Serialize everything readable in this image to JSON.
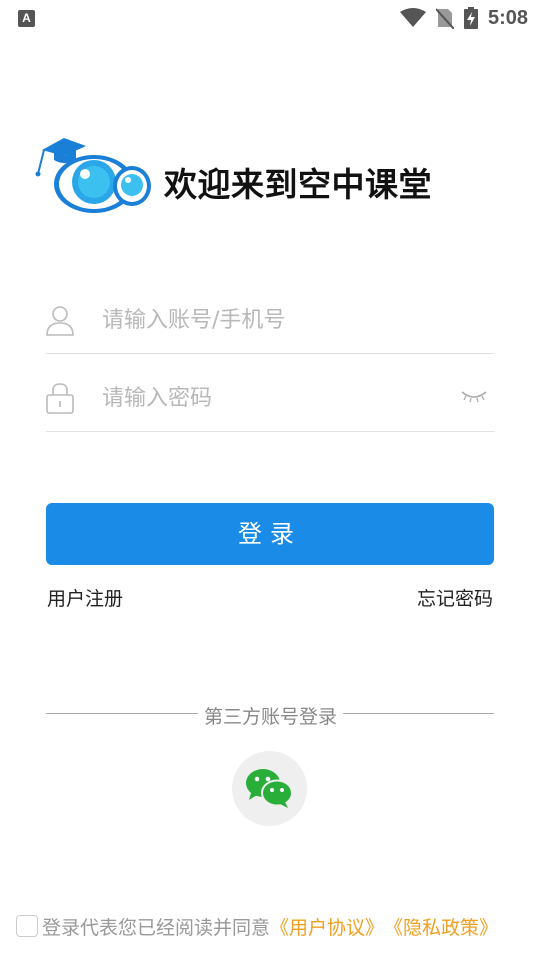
{
  "status_bar": {
    "left_icon_letter": "A",
    "time": "5:08"
  },
  "header": {
    "welcome_text": "欢迎来到空中课堂"
  },
  "login_form": {
    "username_placeholder": "请输入账号/手机号",
    "password_placeholder": "请输入密码",
    "login_label": "登录",
    "register_label": "用户注册",
    "forgot_label": "忘记密码"
  },
  "third_party": {
    "label": "第三方账号登录"
  },
  "agreement": {
    "prefix": "登录代表您已经阅读并同意",
    "user_agreement": "《用户协议》",
    "privacy_policy": "《隐私政策》"
  },
  "colors": {
    "primary": "#1a8ce8",
    "link_orange": "#f0a020",
    "wechat_green": "#2aae3a"
  }
}
